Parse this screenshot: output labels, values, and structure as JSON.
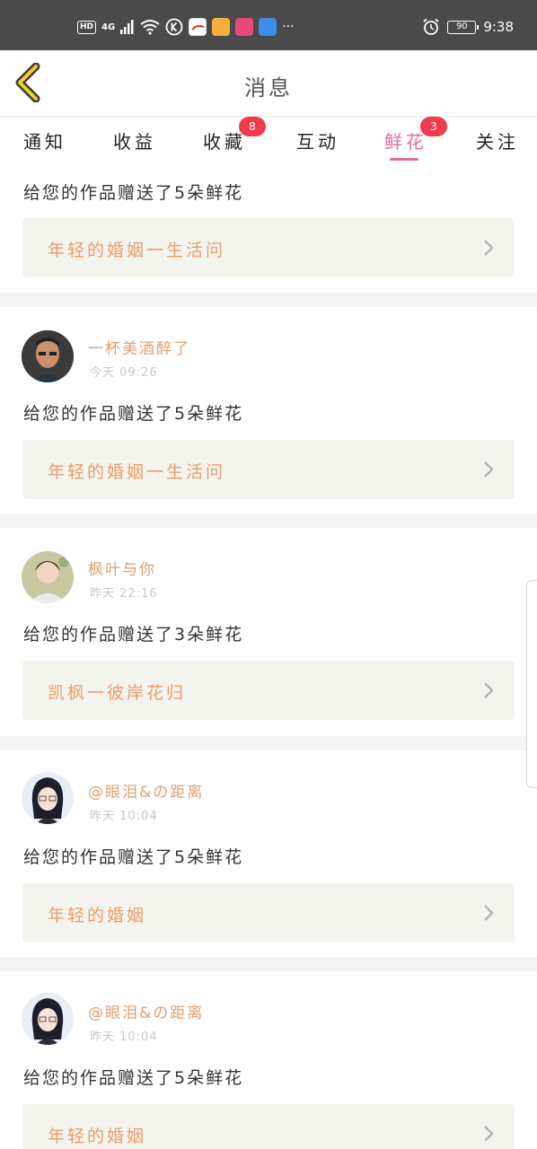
{
  "status_bar": {
    "hd": "HD",
    "network": "4G",
    "more": "···",
    "battery": "90",
    "time": "9:38",
    "icons": [
      "signal-icon",
      "wifi-icon",
      "k-app-icon",
      "news-app-icon",
      "yellow-app-icon",
      "pink-app-icon",
      "game-app-icon",
      "alarm-icon",
      "battery-icon"
    ]
  },
  "header": {
    "title": "消息",
    "back_icon": "chevron-left-icon"
  },
  "tabs": [
    {
      "label": "通知",
      "badge": ""
    },
    {
      "label": "收益",
      "badge": ""
    },
    {
      "label": "收藏",
      "badge": "8"
    },
    {
      "label": "互动",
      "badge": ""
    },
    {
      "label": "鲜花",
      "badge": "3",
      "active": true
    },
    {
      "label": "关注",
      "badge": ""
    }
  ],
  "accent_color": "#e46aa0",
  "badge_color": "#ef3b4c",
  "items": [
    {
      "user": "",
      "time": "",
      "message": "给您的作品赠送了5朵鲜花",
      "work_title": "年轻的婚姻一生活问"
    },
    {
      "user": "一杯美酒醉了",
      "time": "今天 09:26",
      "message": "给您的作品赠送了5朵鲜花",
      "work_title": "年轻的婚姻一生活问"
    },
    {
      "user": "枫叶与你",
      "time": "昨天 22:16",
      "message": "给您的作品赠送了3朵鲜花",
      "work_title": "凯枫一彼岸花归"
    },
    {
      "user": "@眼泪&の距离",
      "time": "昨天 10:04",
      "message": "给您的作品赠送了5朵鲜花",
      "work_title": "年轻的婚姻"
    },
    {
      "user": "@眼泪&の距离",
      "time": "昨天 10:04",
      "message": "给您的作品赠送了5朵鲜花",
      "work_title": "年轻的婚姻"
    }
  ]
}
